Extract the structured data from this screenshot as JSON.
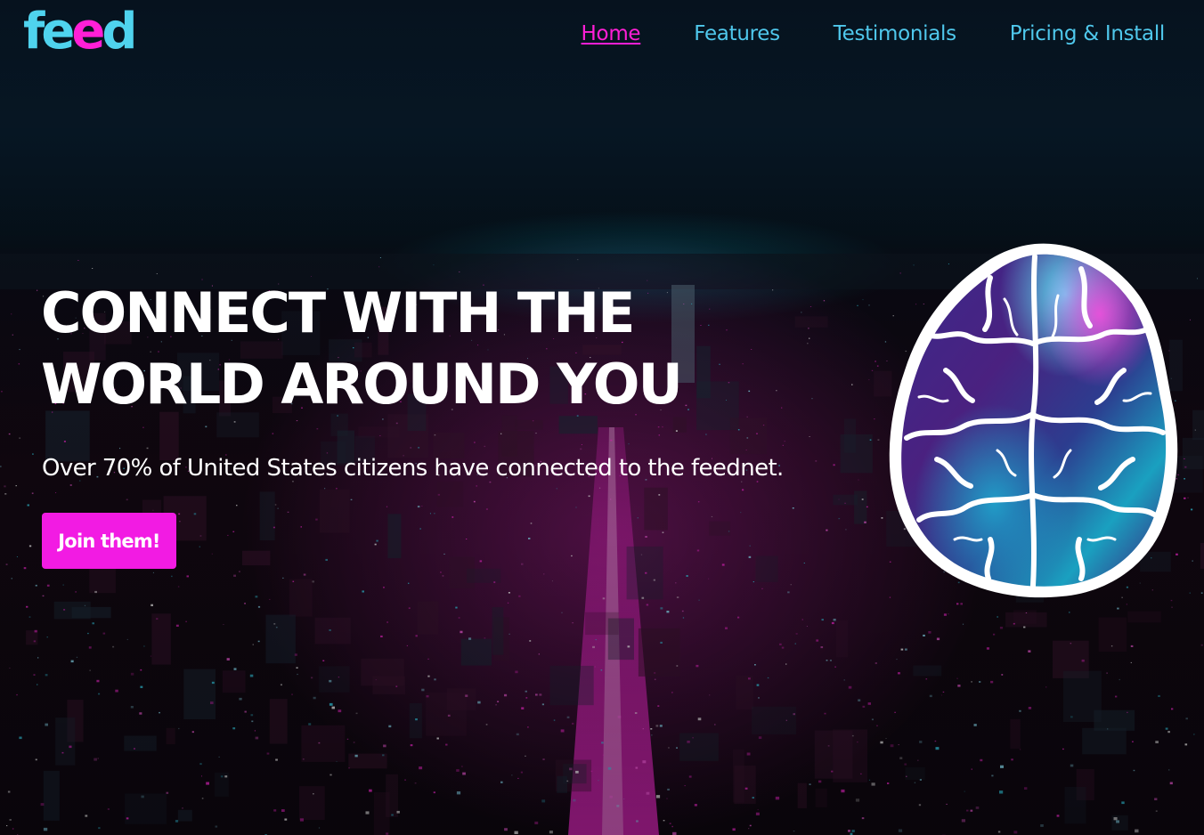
{
  "logo": {
    "part1": "fe",
    "part2": "e",
    "part3": "d"
  },
  "nav": {
    "items": [
      {
        "label": "Home",
        "active": true
      },
      {
        "label": "Features",
        "active": false
      },
      {
        "label": "Testimonials",
        "active": false
      },
      {
        "label": "Pricing & Install",
        "active": false
      }
    ]
  },
  "hero": {
    "title_line1": "CONNECT WITH THE",
    "title_line2": "WORLD AROUND YOU",
    "subtitle": "Over 70% of United States citizens have connected to the feednet.",
    "cta_label": "Join them!"
  },
  "images": {
    "background": "night-city-skyline",
    "hero_image": "brain-illustration"
  },
  "colors": {
    "accent_pink": "#f21be3",
    "accent_cyan": "#4fc8ec",
    "text": "#ffffff",
    "background": "#05060c"
  }
}
